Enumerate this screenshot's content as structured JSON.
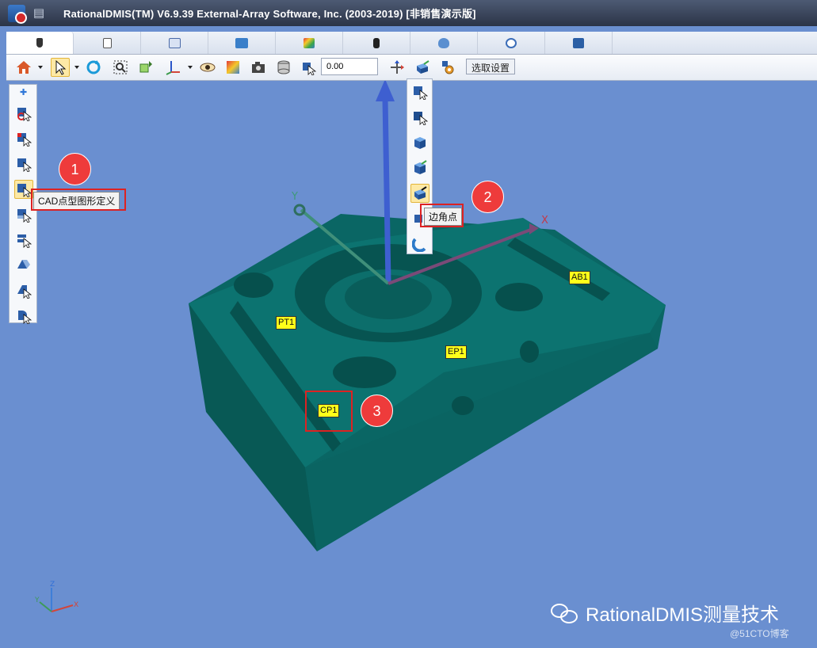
{
  "window": {
    "title": "RationalDMIS(TM) V6.9.39    External-Array Software, Inc. (2003-2019) [非销售演示版]"
  },
  "tabs": [
    {
      "icon": "probe-icon",
      "color": "#333"
    },
    {
      "icon": "document-icon",
      "color": "#555"
    },
    {
      "icon": "table-icon",
      "color": "#4a6aa8"
    },
    {
      "icon": "print-icon",
      "color": "#3a7fc9"
    },
    {
      "icon": "color-cube-icon",
      "color": "#3aa64a"
    },
    {
      "icon": "stylus-icon",
      "color": "#222"
    },
    {
      "icon": "shield-icon",
      "color": "#5a8fd0"
    },
    {
      "icon": "disc-icon",
      "color": "#3b6db8"
    },
    {
      "icon": "report-icon",
      "color": "#2b5fa5"
    }
  ],
  "toolbar": {
    "value_input": "0.00",
    "tooltip_settings": "选取设置"
  },
  "left_toolbar": {
    "tooltip": "CAD点型图形定义"
  },
  "flyout": {
    "tooltip": "边角点"
  },
  "callouts": [
    "1",
    "2",
    "3"
  ],
  "feature_labels": {
    "pt1": "PT1",
    "ep1": "EP1",
    "ab1": "AB1",
    "cp1": "CP1"
  },
  "axes": {
    "x": "X",
    "y": "Y",
    "mini_x": "X",
    "mini_y": "Y",
    "mini_z": "Z"
  },
  "watermark": {
    "text": "RationalDMIS测量技术",
    "source": "@51CTO博客"
  },
  "colors": {
    "viewport_bg": "#6a8fd0",
    "part": "#0b6c6a",
    "highlight": "#fde9a6",
    "callout": "#ee3b3b",
    "label_bg": "#ffff1a"
  }
}
